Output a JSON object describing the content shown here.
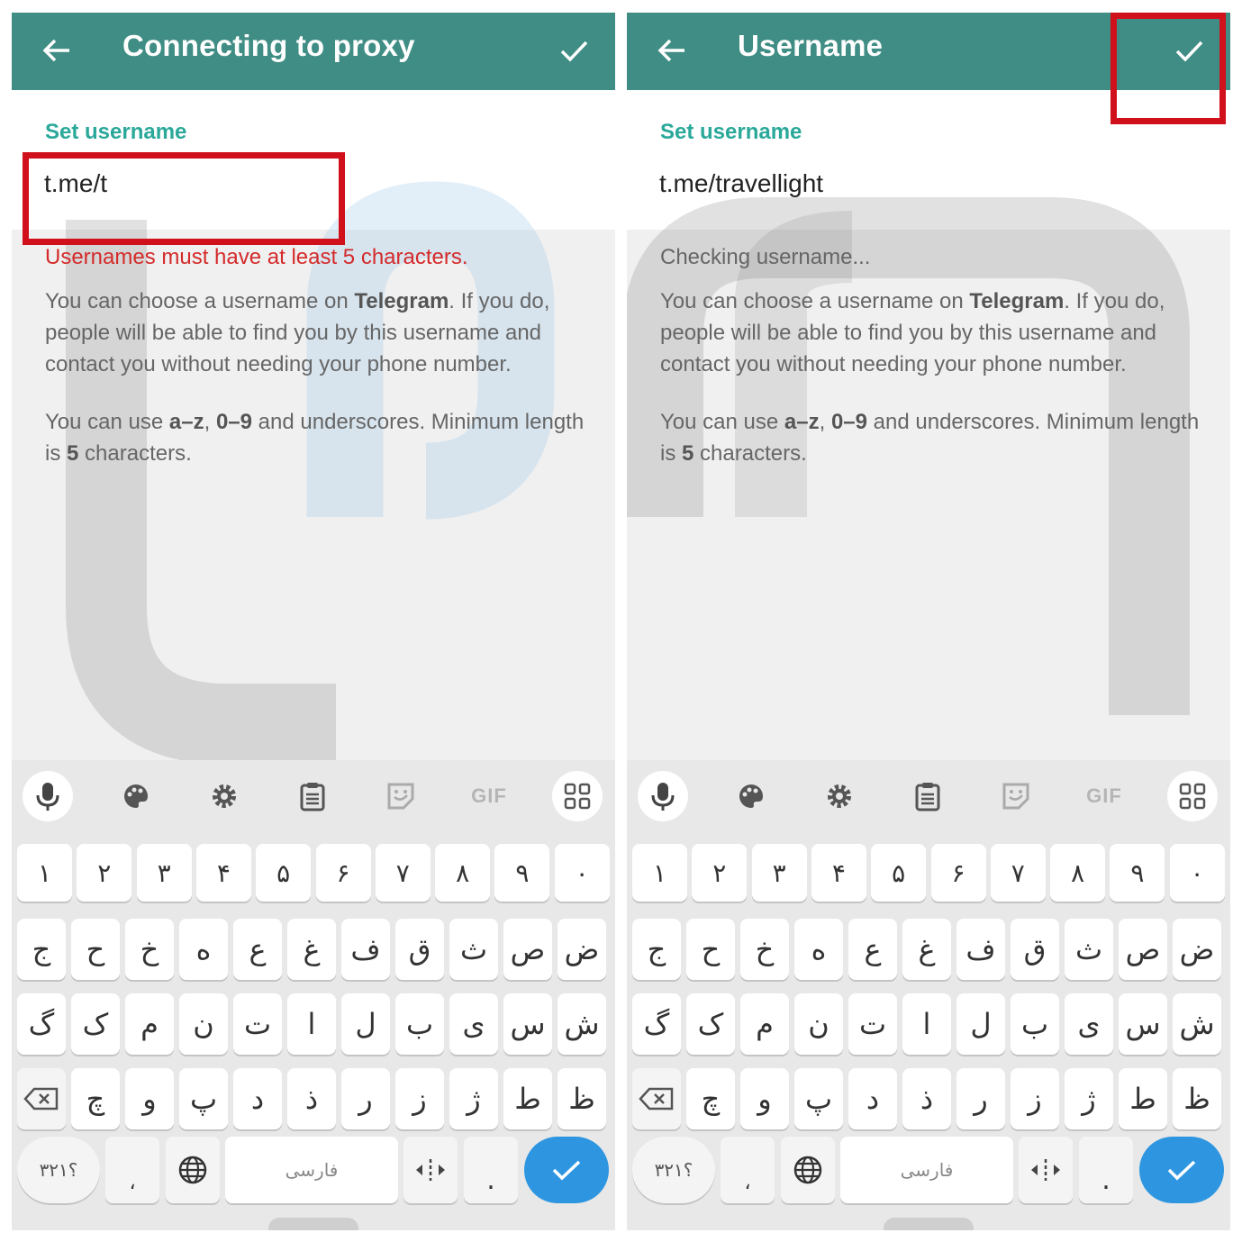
{
  "screens": [
    {
      "id": "left",
      "header_title": "Connecting to proxy",
      "section_label": "Set username",
      "username_prefix": "t.me/",
      "username_value": "t",
      "status_text": "Usernames must have at least 5 characters.",
      "status_type": "error",
      "highlight": "username-field"
    },
    {
      "id": "right",
      "header_title": "Username",
      "section_label": "Set username",
      "username_prefix": "t.me/",
      "username_value": "travellight",
      "status_text": "Checking username...",
      "status_type": "checking",
      "highlight": "done-check-button"
    }
  ],
  "help": {
    "p1_a": "You can choose a username on ",
    "p1_b": "Telegram",
    "p1_c": ". If you do, people will be able to find you by this username and contact you without needing your phone number.",
    "p2_a": "You can use ",
    "p2_b": "a–z",
    "p2_c": ", ",
    "p2_d": "0–9",
    "p2_e": " and underscores. Minimum length is ",
    "p2_f": "5",
    "p2_g": " characters."
  },
  "keyboard": {
    "toolbar": [
      "mic-icon",
      "palette-icon",
      "gear-icon",
      "clipboard-icon",
      "sticker-icon",
      "GIF",
      "apps-grid-icon"
    ],
    "gif_label": "GIF",
    "row_numbers": [
      "۱",
      "۲",
      "۳",
      "۴",
      "۵",
      "۶",
      "۷",
      "۸",
      "۹",
      "۰"
    ],
    "row1": [
      "ض",
      "ص",
      "ث",
      "ق",
      "ف",
      "غ",
      "ع",
      "ه",
      "خ",
      "ح",
      "ج"
    ],
    "row2": [
      "ش",
      "س",
      "ی",
      "ب",
      "ل",
      "ا",
      "ت",
      "ن",
      "م",
      "ک",
      "گ"
    ],
    "row3": [
      "ظ",
      "ط",
      "ژ",
      "ز",
      "ر",
      "ذ",
      "د",
      "پ",
      "و",
      "چ"
    ],
    "symbols_key": "؟۳۲۱",
    "comma_key": "،",
    "space_label": "فارسی",
    "period_key": ".",
    "colors": {
      "header": "#3f8d84",
      "accent": "#2aa89a",
      "error": "#d42a2a",
      "enter": "#2e96e0",
      "highlight": "#d0101a"
    }
  }
}
